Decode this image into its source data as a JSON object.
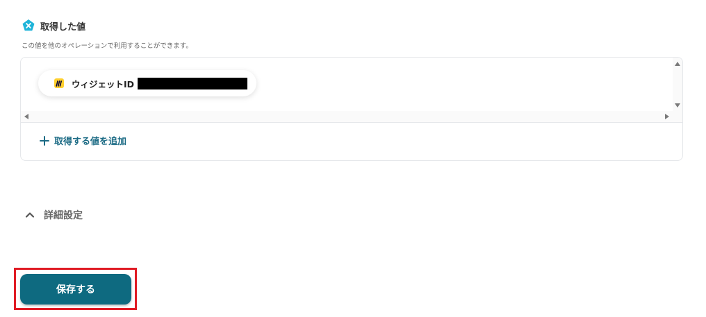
{
  "section": {
    "title": "取得した値",
    "description": "この値を他のオペレーションで利用することができます。",
    "icon": "yoom-x-icon"
  },
  "values": {
    "items": [
      {
        "label": "ウィジェットID",
        "value": "",
        "icon": "miro-icon",
        "redacted": true
      }
    ],
    "add_label": "取得する値を追加"
  },
  "advanced": {
    "label": "詳細設定",
    "icon": "chevron-up-icon"
  },
  "footer": {
    "save_label": "保存する"
  },
  "colors": {
    "accent": "#0e6a80",
    "link": "#1c6b85",
    "icon_teal": "#1fb4d9",
    "miro_yellow": "#ffd02f",
    "highlight": "#e01b24"
  }
}
